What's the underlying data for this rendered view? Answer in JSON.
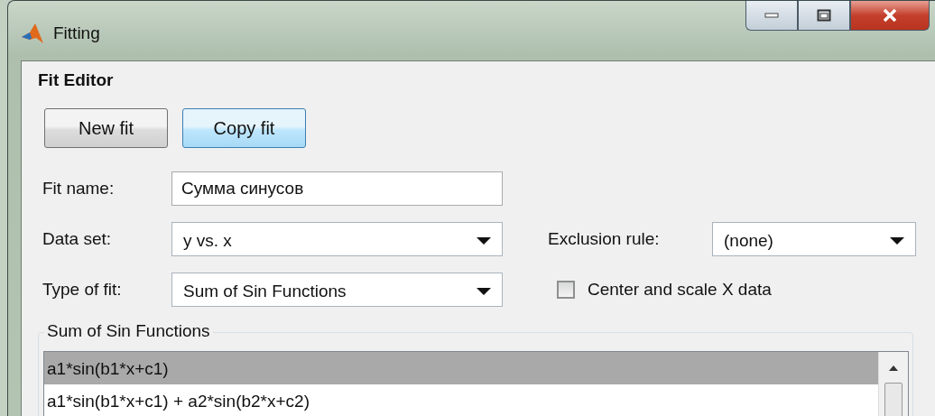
{
  "window": {
    "title": "Fitting"
  },
  "panel": {
    "title": "Fit Editor"
  },
  "buttons": [
    {
      "label": "New fit",
      "focused": false
    },
    {
      "label": "Copy fit",
      "focused": true
    }
  ],
  "fit_name": {
    "label": "Fit name:",
    "value": "Сумма синусов"
  },
  "data_set": {
    "label": "Data set:",
    "value": "y vs. x"
  },
  "exclusion_rule": {
    "label": "Exclusion rule:",
    "value": "(none)"
  },
  "type_of_fit": {
    "label": "Type of fit:",
    "value": "Sum of Sin Functions"
  },
  "center_scale": {
    "label": "Center and scale X data",
    "checked": false
  },
  "group": {
    "title": "Sum of Sin Functions",
    "items": [
      {
        "label": "a1*sin(b1*x+c1)",
        "selected": true
      },
      {
        "label": "a1*sin(b1*x+c1) + a2*sin(b2*x+c2)",
        "selected": false
      }
    ]
  }
}
